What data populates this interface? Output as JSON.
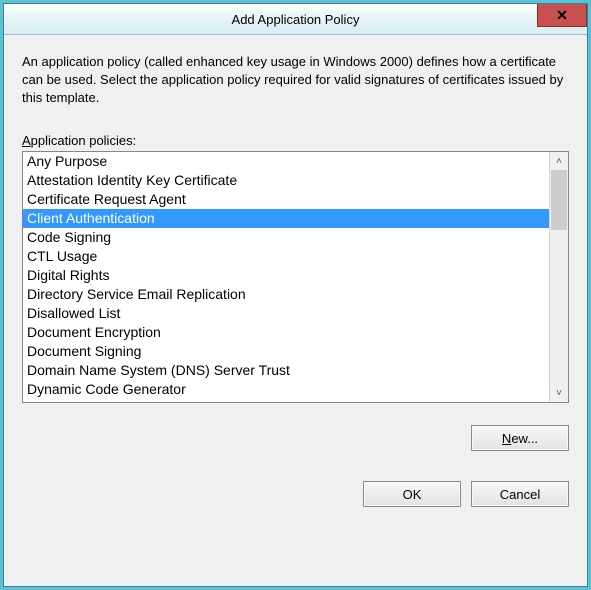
{
  "window": {
    "title": "Add Application Policy",
    "close_glyph": "✕",
    "description": "An application policy (called enhanced key usage in Windows 2000) defines how a certificate can be used. Select the application policy required for valid signatures of certificates issued by this template.",
    "list_label_prefix": "A",
    "list_label_rest": "pplication policies:"
  },
  "policies": [
    "Any Purpose",
    "Attestation Identity Key Certificate",
    "Certificate Request Agent",
    "Client Authentication",
    "Code Signing",
    "CTL Usage",
    "Digital Rights",
    "Directory Service Email Replication",
    "Disallowed List",
    "Document Encryption",
    "Document Signing",
    "Domain Name System (DNS) Server Trust",
    "Dynamic Code Generator"
  ],
  "selected_index": 3,
  "buttons": {
    "new_prefix": "N",
    "new_rest": "ew...",
    "ok": "OK",
    "cancel": "Cancel"
  }
}
